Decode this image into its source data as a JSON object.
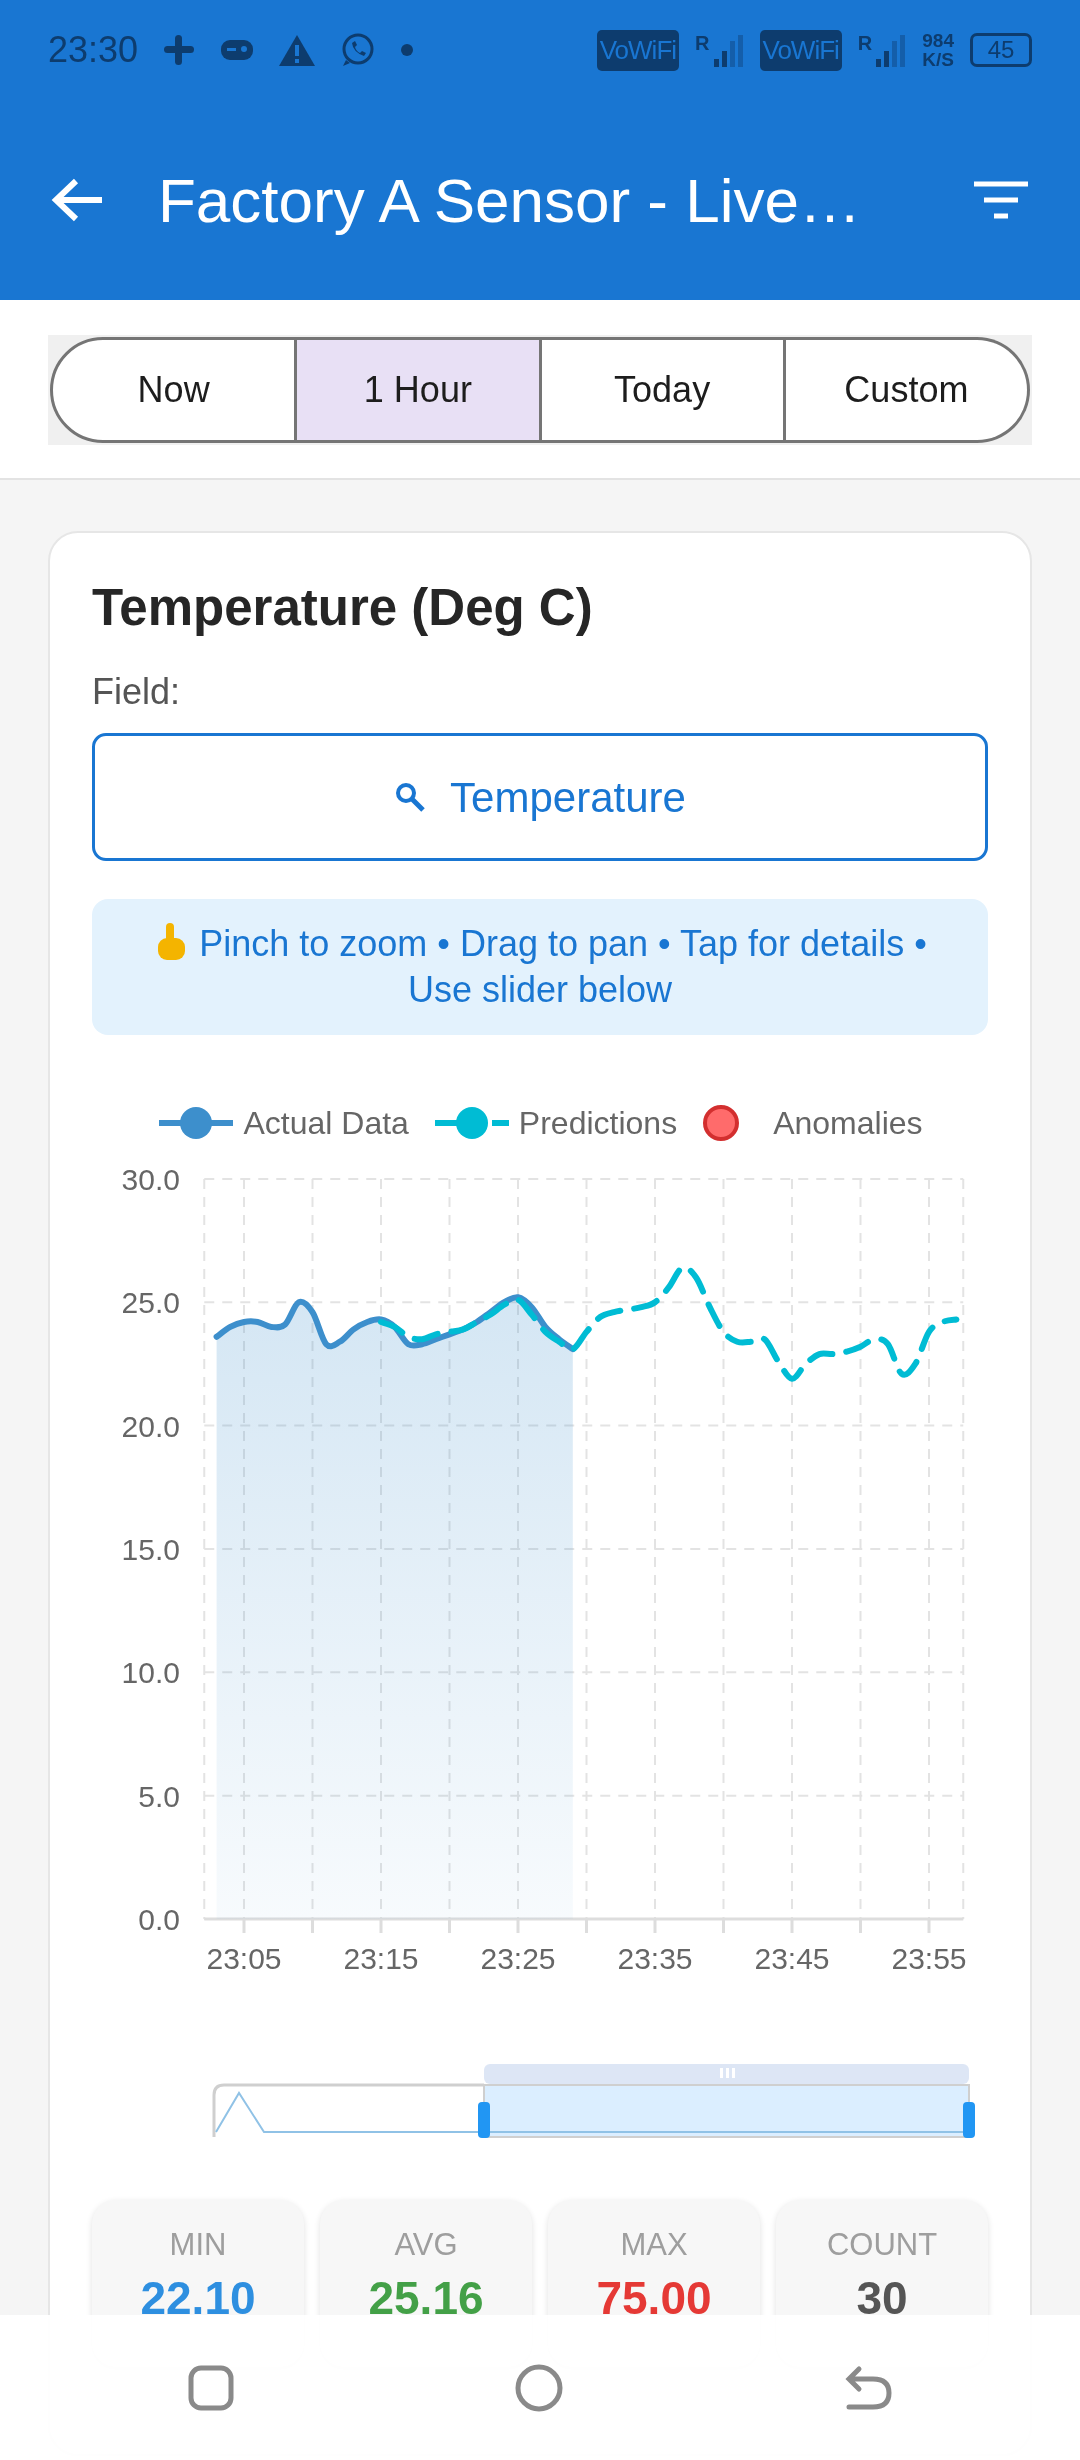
{
  "status_bar": {
    "time": "23:30",
    "network_badges": [
      "VoWiFi",
      "VoWiFi"
    ],
    "roaming": [
      "R",
      "R"
    ],
    "speed": "984",
    "speed_unit": "K/S",
    "battery": "45"
  },
  "app_bar": {
    "title": "Factory A  Sensor - Live…"
  },
  "range_tabs": [
    {
      "label": "Now",
      "selected": false
    },
    {
      "label": "1 Hour",
      "selected": true
    },
    {
      "label": "Today",
      "selected": false
    },
    {
      "label": "Custom",
      "selected": false
    }
  ],
  "card": {
    "title": "Temperature (Deg C)",
    "field_label": "Field:",
    "field_value": "Temperature",
    "hint": "Pinch to zoom • Drag to pan • Tap for details • Use slider below",
    "chart_data": {
      "type": "line",
      "grid": true,
      "ylim": [
        0,
        30
      ],
      "categories": [
        null,
        null,
        "23:05",
        null,
        null,
        null,
        null,
        null,
        null,
        null,
        null,
        null,
        "23:15",
        null,
        null,
        null,
        null,
        null,
        null,
        null,
        null,
        null,
        "23:25",
        null,
        null,
        null,
        null,
        null,
        null,
        null,
        null,
        null,
        "23:35",
        null,
        null,
        null,
        null,
        null,
        null,
        null,
        null,
        null,
        "23:45",
        null,
        null,
        null,
        null,
        null,
        null,
        null,
        null,
        null,
        "23:55",
        null,
        null
      ],
      "yticks": [
        {
          "value": 0,
          "label": "0.0"
        },
        {
          "value": 5,
          "label": "5.0"
        },
        {
          "value": 10,
          "label": "10.0"
        },
        {
          "value": 15,
          "label": "15.0"
        },
        {
          "value": 20,
          "label": "20.0"
        },
        {
          "value": 25,
          "label": "25.0"
        },
        {
          "value": 30,
          "label": "30.0"
        }
      ],
      "series": [
        {
          "name": "Actual Data",
          "line_style": "solid",
          "color": "#3d8fcc",
          "values": [
            23.6,
            24.0,
            24.2,
            24.2,
            24.0,
            24.1,
            25.0,
            24.6,
            23.3,
            23.4,
            23.9,
            24.2,
            24.3,
            24.0,
            23.3,
            23.3,
            23.5,
            23.7,
            23.9,
            24.2,
            24.6,
            25.0,
            25.2,
            24.8,
            24.0,
            23.5,
            23.1,
            null,
            null,
            null,
            null,
            null,
            null,
            null,
            null,
            null,
            null,
            null,
            null,
            null,
            null,
            null,
            null,
            null,
            null,
            null,
            null,
            null,
            null,
            null,
            null,
            null,
            null,
            null,
            null
          ]
        },
        {
          "name": "Predictions",
          "line_style": "dashed",
          "color": "#00bcd4",
          "values": [
            null,
            null,
            null,
            null,
            null,
            null,
            null,
            null,
            null,
            null,
            null,
            null,
            24.2,
            24.0,
            23.6,
            23.5,
            23.7,
            23.8,
            23.9,
            24.2,
            24.5,
            24.9,
            25.1,
            24.5,
            23.8,
            23.4,
            23.1,
            23.8,
            24.4,
            24.6,
            24.7,
            24.8,
            25.0,
            25.6,
            26.4,
            26.0,
            24.8,
            23.8,
            23.4,
            23.4,
            23.5,
            22.6,
            21.9,
            22.5,
            22.9,
            22.9,
            23.0,
            23.2,
            23.5,
            23.3,
            22.1,
            22.5,
            23.8,
            24.2,
            24.3
          ]
        },
        {
          "name": "Anomalies",
          "line_style": "none",
          "color": "#ff6b6b",
          "values": [
            null,
            null,
            null,
            null,
            null,
            null,
            null,
            null,
            null,
            null,
            null,
            null,
            null,
            null,
            null,
            null,
            null,
            null,
            null,
            null,
            null,
            null,
            null,
            null,
            null,
            null,
            null,
            null,
            null,
            null,
            null,
            null,
            null,
            null,
            null,
            null,
            null,
            null,
            null,
            null,
            null,
            null,
            null,
            null,
            null,
            null,
            null,
            null,
            null,
            null,
            null,
            null,
            null,
            null,
            null
          ]
        }
      ]
    },
    "stats": [
      {
        "label": "MIN",
        "value": "22.10",
        "color": "#2e8fe0"
      },
      {
        "label": "AVG",
        "value": "25.16",
        "color": "#43a047"
      },
      {
        "label": "MAX",
        "value": "75.00",
        "color": "#e53935"
      },
      {
        "label": "COUNT",
        "value": "30",
        "color": "#555555"
      }
    ]
  }
}
